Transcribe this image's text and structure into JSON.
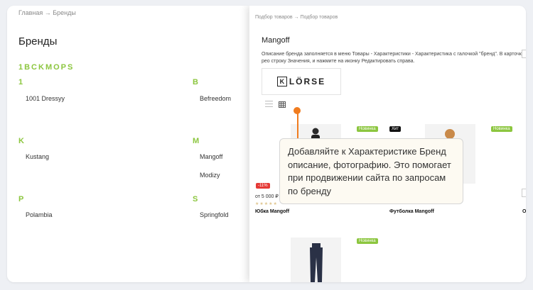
{
  "left_panel": {
    "breadcrumb": "Главная → Бренды",
    "title": "Бренды",
    "letters": "1BCKMOPS",
    "groups": [
      {
        "letter": "1",
        "brands": [
          "1001 Dressyy"
        ]
      },
      {
        "letter": "B",
        "brands": [
          "Befreedom"
        ]
      },
      {
        "letter": "K",
        "brands": [
          "Kustang"
        ]
      },
      {
        "letter": "M",
        "brands": [
          "Mangoff",
          "Modizy"
        ]
      },
      {
        "letter": "P",
        "brands": [
          "Polambia"
        ]
      },
      {
        "letter": "S",
        "brands": [
          "Springfold"
        ]
      }
    ]
  },
  "right_panel": {
    "breadcrumb": "Подбор товаров → Подбор товаров",
    "title": "Mangoff",
    "description": "Описание бренда заполняется в меню Товары - Характеристики - Характеристика с галочкой \"бренд\". В карточке рео строку Значения, и нажмите на иконку Редактировать справа.",
    "logo": {
      "mark": "K",
      "text": "LÖRSE"
    },
    "view_icons": {
      "list": "list-icon",
      "grid": "grid-icon"
    },
    "products": [
      {
        "badge": "Новинка",
        "discount": "-11%",
        "price": "от 5 000 ₽",
        "name": "Юбка Mangoff"
      },
      {
        "badge_hit": "Хит",
        "badge": "Новинка",
        "name": "Футболка Mangoff"
      },
      {
        "badge": "Новинка"
      }
    ],
    "edge_name": "О",
    "colors": {
      "accent": "#8cc63f",
      "pin": "#f07c1f",
      "discount": "#e53935"
    }
  },
  "callout": {
    "text": "Добавляйте к Характеристике Бренд описание, фотографию. Это помогает при продвижении сайта по запросам по бренду"
  }
}
